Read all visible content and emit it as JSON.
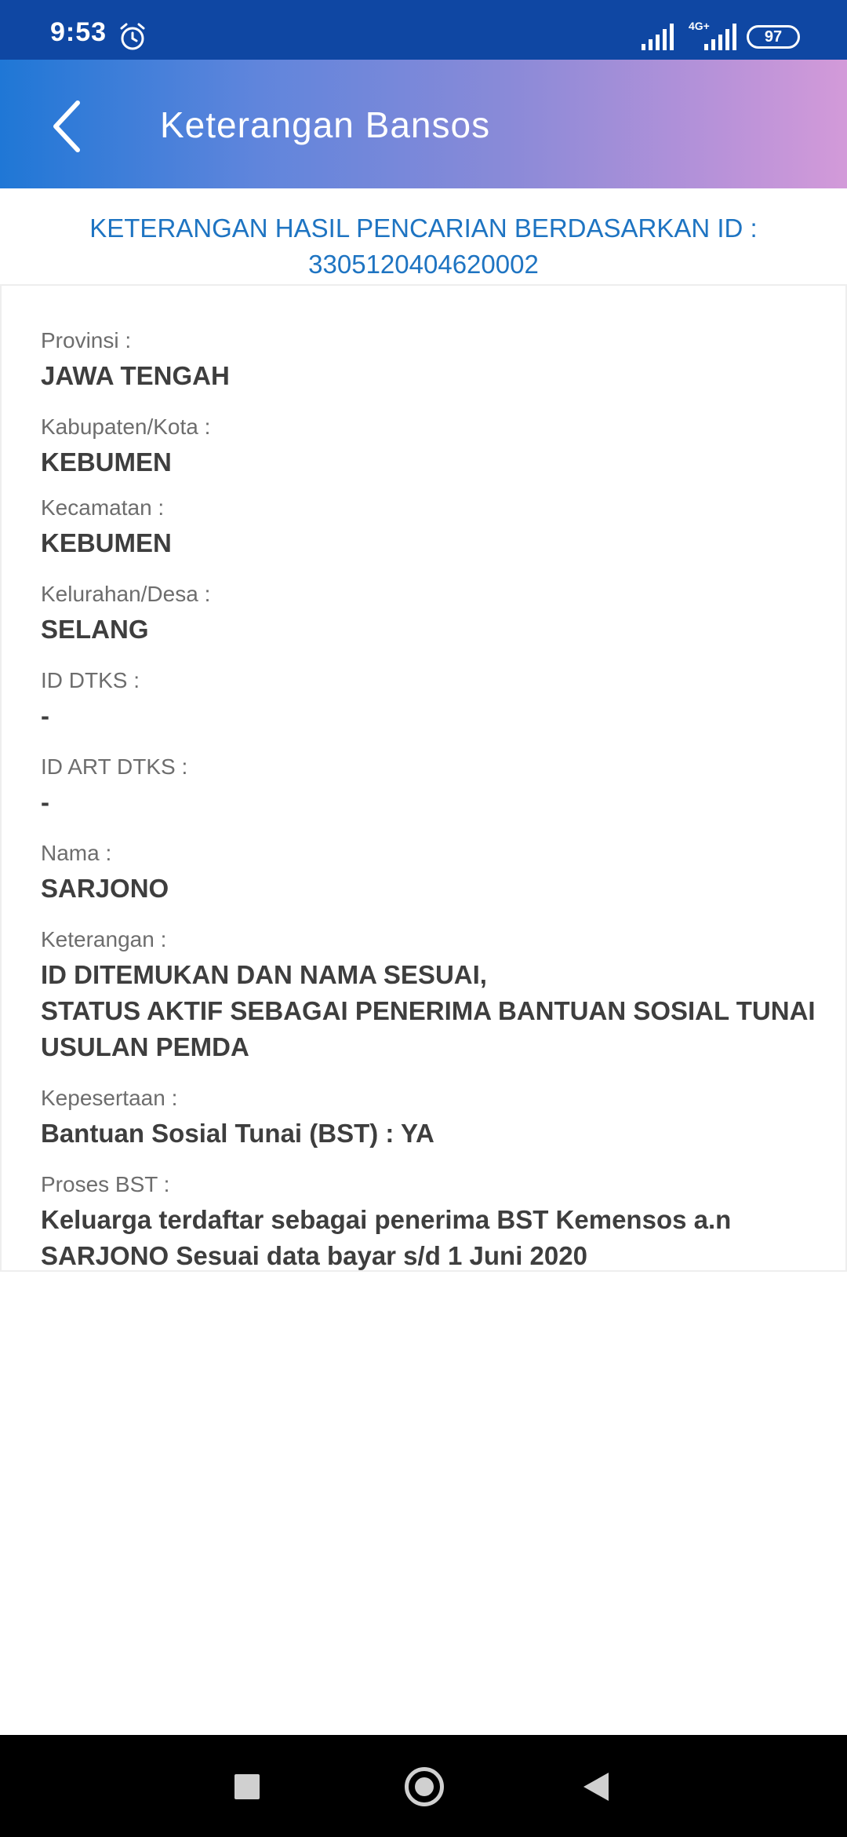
{
  "status_bar": {
    "time": "9:53",
    "network": "4G+",
    "battery": "97"
  },
  "app_bar": {
    "title": "Keterangan Bansos",
    "back_icon": "chevron-left-icon"
  },
  "heading": {
    "line1": "KETERANGAN HASIL PENCARIAN BERDASARKAN ID :",
    "line2": "3305120404620002"
  },
  "fields": [
    {
      "label": "Provinsi :",
      "value": "JAWA TENGAH"
    },
    {
      "label": "Kabupaten/Kota :",
      "value": "KEBUMEN"
    },
    {
      "label": "Kecamatan :",
      "value": "KEBUMEN"
    },
    {
      "label": "Kelurahan/Desa :",
      "value": "SELANG"
    },
    {
      "label": "ID DTKS :",
      "value": "-"
    },
    {
      "label": "ID ART DTKS :",
      "value": "-"
    },
    {
      "label": "Nama :",
      "value": "SARJONO"
    },
    {
      "label": "Keterangan :",
      "value_lines": [
        "ID DITEMUKAN DAN NAMA SESUAI,",
        "STATUS AKTIF SEBAGAI PENERIMA BANTUAN SOSIAL TUNAI",
        "USULAN PEMDA"
      ]
    },
    {
      "label": "Kepesertaan :",
      "value": "Bantuan Sosial Tunai (BST) : YA"
    },
    {
      "label": "Proses BST :",
      "value_lines": [
        "Keluarga terdaftar sebagai penerima BST Kemensos a.n",
        "SARJONO Sesuai data bayar s/d 1 Juni 2020"
      ]
    }
  ],
  "colors": {
    "status_bar": "#0f47a3",
    "heading": "#1e74c2",
    "label": "#6d6d6d",
    "value": "#3e3e3e"
  }
}
